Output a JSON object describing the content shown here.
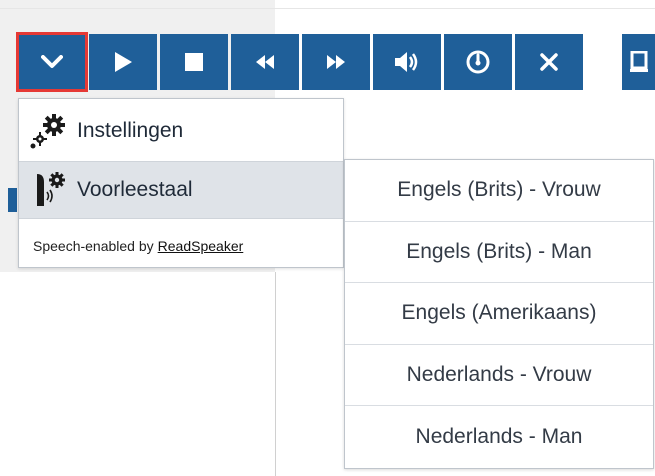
{
  "toolbar": {
    "buttons": [
      {
        "name": "menu-toggle-button",
        "icon": "chevron-down-icon",
        "highlighted": true
      },
      {
        "name": "play-button",
        "icon": "play-icon"
      },
      {
        "name": "stop-button",
        "icon": "stop-icon"
      },
      {
        "name": "rewind-button",
        "icon": "rewind-icon"
      },
      {
        "name": "fast-forward-button",
        "icon": "fast-forward-icon"
      },
      {
        "name": "volume-button",
        "icon": "volume-icon"
      },
      {
        "name": "speed-button",
        "icon": "speedometer-icon"
      },
      {
        "name": "close-button",
        "icon": "close-icon"
      }
    ],
    "edge_button_icon": "document-icon",
    "button_color": "#1f5f99",
    "highlight_color": "#e53935"
  },
  "menu": {
    "settings_label": "Instellingen",
    "settings_icon": "gears-icon",
    "language_label": "Voorleestaal",
    "language_icon": "speaker-gear-icon",
    "footer_prefix": "Speech-enabled by",
    "footer_link": "ReadSpeaker"
  },
  "language_submenu": {
    "options": [
      "Engels (Brits) - Vrouw",
      "Engels (Brits) - Man",
      "Engels (Amerikaans)",
      "Nederlands - Vrouw",
      "Nederlands - Man"
    ]
  }
}
